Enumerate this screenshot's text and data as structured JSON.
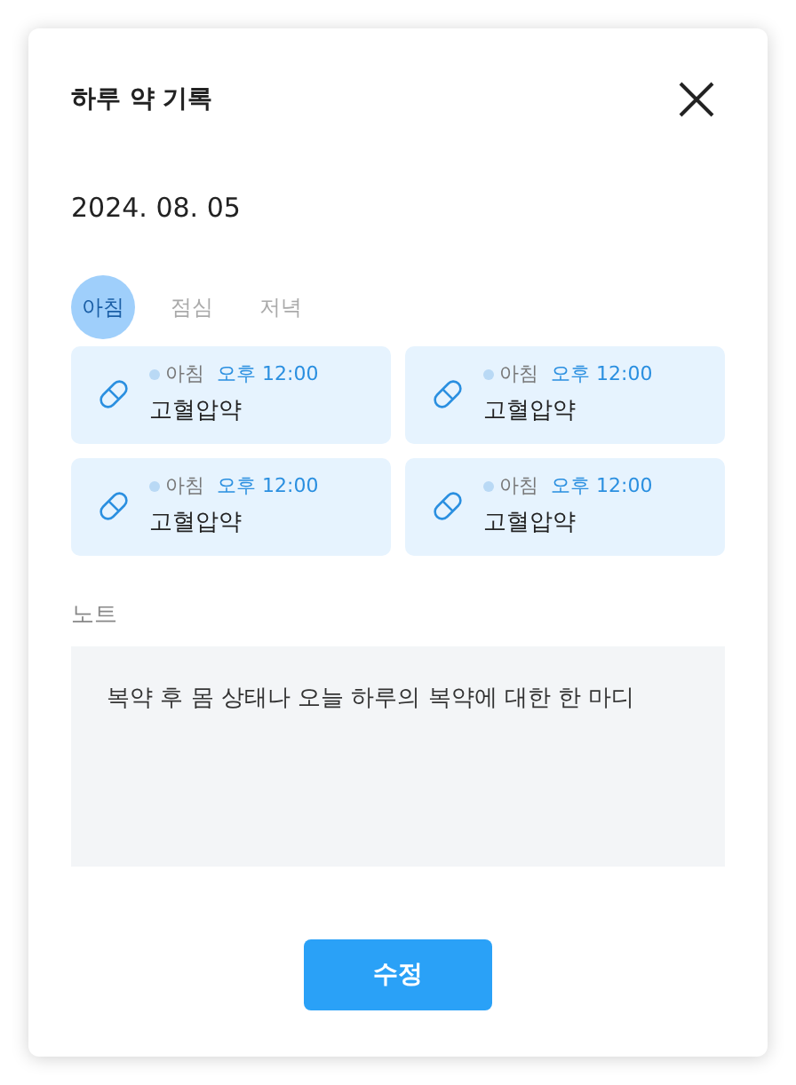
{
  "dialog": {
    "title": "하루 약 기록",
    "date": "2024. 08. 05"
  },
  "tabs": [
    {
      "label": "아침",
      "selected": true
    },
    {
      "label": "점심",
      "selected": false
    },
    {
      "label": "저녁",
      "selected": false
    }
  ],
  "medications": [
    {
      "period": "아침",
      "time": "오후 12:00",
      "name": "고혈압약"
    },
    {
      "period": "아침",
      "time": "오후 12:00",
      "name": "고혈압약"
    },
    {
      "period": "아침",
      "time": "오후 12:00",
      "name": "고혈압약"
    },
    {
      "period": "아침",
      "time": "오후 12:00",
      "name": "고혈압약"
    }
  ],
  "note": {
    "label": "노트",
    "value": "복약 후 몸 상태나 오늘 하루의 복약에 대한 한 마디"
  },
  "buttons": [
    "수정"
  ]
}
